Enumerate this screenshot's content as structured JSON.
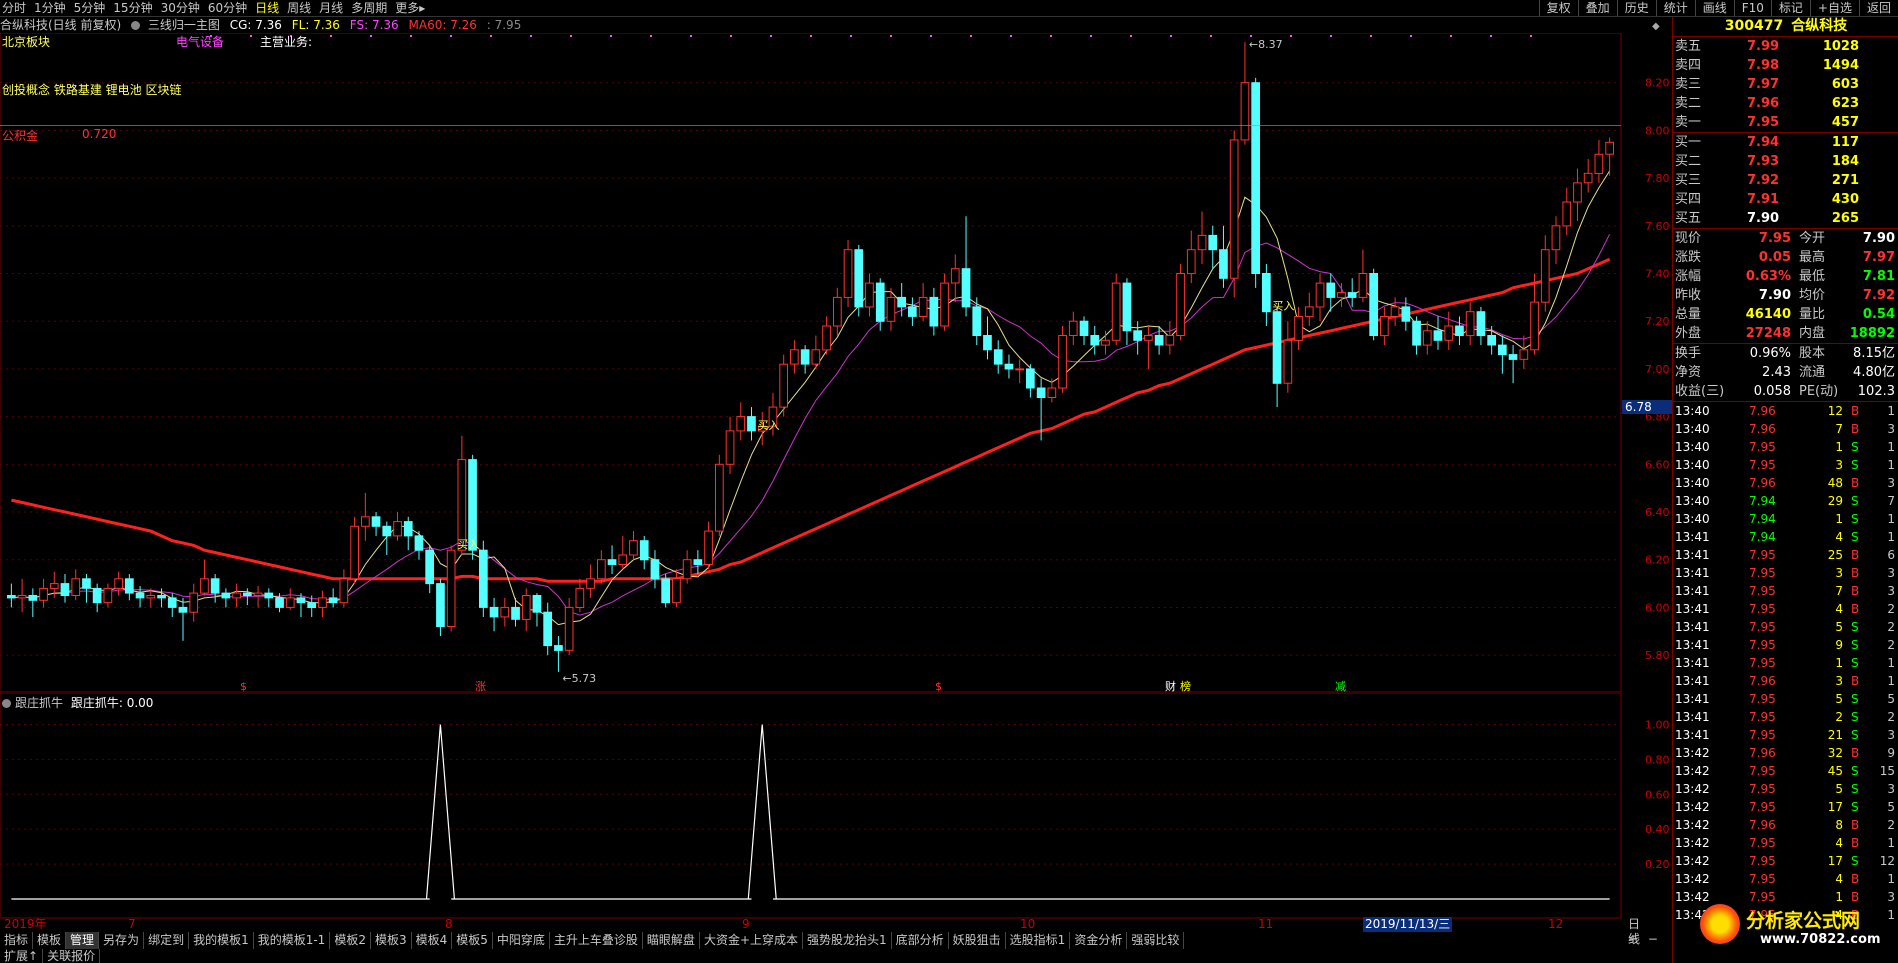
{
  "toolbar": {
    "periods": [
      "分时",
      "1分钟",
      "5分钟",
      "15分钟",
      "30分钟",
      "60分钟",
      "日线",
      "周线",
      "月线",
      "多周期",
      "更多▸"
    ],
    "active_period": "日线",
    "right_tools": [
      "复权",
      "叠加",
      "历史",
      "统计",
      "画线",
      "F10",
      "标记",
      "+自选",
      "返回"
    ]
  },
  "info": {
    "stock": "合纵科技(日线 前复权)",
    "indicator": "三线归一主图",
    "cg": "CG: 7.36",
    "fl": "FL: 7.36",
    "fs": "FS: 7.36",
    "ma60": "MA60: 7.26",
    "extra": ": 7.95"
  },
  "overlay": {
    "block": "北京板块",
    "sector": "电气设备",
    "main_business": "主营业务:",
    "concept": "创投概念 铁路基建 锂电池 区块链",
    "provident": "公积金",
    "provident_val": "0.720",
    "high_mark": "8.37",
    "low_mark": "5.73",
    "buy_label": "买入",
    "price_marker": "6.78"
  },
  "main_axis": [
    "8.20",
    "8.00",
    "7.80",
    "7.60",
    "7.40",
    "7.20",
    "7.00",
    "6.80",
    "6.60",
    "6.40",
    "6.20",
    "6.00",
    "5.80"
  ],
  "event_marks": [
    {
      "text": "$",
      "color": "#ff3030"
    },
    {
      "text": "涨",
      "color": "#ff3030"
    },
    {
      "text": "$",
      "color": "#ff3030"
    },
    {
      "text": "财",
      "color": "#ffffff"
    },
    {
      "text": "榜",
      "color": "#ffff00"
    },
    {
      "text": "减",
      "color": "#00ff00"
    }
  ],
  "sub": {
    "title": "跟庄抓牛",
    "value": "跟庄抓牛: 0.00",
    "axis": [
      "1.00",
      "0.80",
      "0.60",
      "0.40",
      "0.20"
    ]
  },
  "xaxis": {
    "labels": [
      "2019年",
      "7",
      "8",
      "9",
      "10",
      "11",
      "12"
    ],
    "cursor_date": "2019/11/13/三",
    "period": "日线"
  },
  "bottom_tabs": [
    "指标",
    "模板",
    "管理",
    "另存为",
    "绑定到",
    "我的模板1",
    "我的模板1-1",
    "模板2",
    "模板3",
    "模板4",
    "模板5",
    "中阳穿底",
    "主升上车叠诊股",
    "瞄眼解盘",
    "大资金+上穿成本",
    "强势股龙抬头1",
    "底部分析",
    "妖股狙击",
    "选股指标1",
    "资金分析",
    "强弱比较"
  ],
  "bottom_tabs_active": "管理",
  "bottom_line2": [
    "扩展↑",
    "关联报价"
  ],
  "quote": {
    "code": "300477",
    "name": "合纵科技",
    "asks": [
      {
        "label": "卖五",
        "price": "7.99",
        "vol": "1028"
      },
      {
        "label": "卖四",
        "price": "7.98",
        "vol": "1494"
      },
      {
        "label": "卖三",
        "price": "7.97",
        "vol": "603"
      },
      {
        "label": "卖二",
        "price": "7.96",
        "vol": "623"
      },
      {
        "label": "卖一",
        "price": "7.95",
        "vol": "457"
      }
    ],
    "bids": [
      {
        "label": "买一",
        "price": "7.94",
        "vol": "117"
      },
      {
        "label": "买二",
        "price": "7.93",
        "vol": "184"
      },
      {
        "label": "买三",
        "price": "7.92",
        "vol": "271"
      },
      {
        "label": "买四",
        "price": "7.91",
        "vol": "430"
      },
      {
        "label": "买五",
        "price": "7.90",
        "vol": "265"
      }
    ],
    "stats": [
      {
        "l1": "现价",
        "v1": "7.95",
        "c1": "#ff3030",
        "l2": "今开",
        "v2": "7.90",
        "c2": "#ffffff"
      },
      {
        "l1": "涨跌",
        "v1": "0.05",
        "c1": "#ff3030",
        "l2": "最高",
        "v2": "7.97",
        "c2": "#ff3030"
      },
      {
        "l1": "涨幅",
        "v1": "0.63%",
        "c1": "#ff3030",
        "l2": "最低",
        "v2": "7.81",
        "c2": "#00ff00"
      },
      {
        "l1": "昨收",
        "v1": "7.90",
        "c1": "#ffffff",
        "l2": "均价",
        "v2": "7.92",
        "c2": "#ff3030"
      },
      {
        "l1": "总量",
        "v1": "46140",
        "c1": "#ffff00",
        "l2": "量比",
        "v2": "0.54",
        "c2": "#00ff00"
      },
      {
        "l1": "外盘",
        "v1": "27248",
        "c1": "#ff3030",
        "l2": "内盘",
        "v2": "18892",
        "c2": "#00ff00"
      }
    ],
    "stats2": [
      {
        "l1": "换手",
        "v1": "0.96%",
        "l2": "股本",
        "v2": "8.15亿"
      },
      {
        "l1": "净资",
        "v1": "2.43",
        "l2": "流通",
        "v2": "4.80亿"
      },
      {
        "l1": "收益(三)",
        "v1": "0.058",
        "l2": "PE(动)",
        "v2": "102.3"
      }
    ]
  },
  "ticks": [
    {
      "t": "13:40",
      "p": "7.96",
      "v": "12",
      "s": "B",
      "n": "1"
    },
    {
      "t": "13:40",
      "p": "7.96",
      "v": "7",
      "s": "B",
      "n": "3"
    },
    {
      "t": "13:40",
      "p": "7.95",
      "v": "1",
      "s": "S",
      "n": "1"
    },
    {
      "t": "13:40",
      "p": "7.95",
      "v": "3",
      "s": "S",
      "n": "1"
    },
    {
      "t": "13:40",
      "p": "7.96",
      "v": "48",
      "s": "B",
      "n": "3"
    },
    {
      "t": "13:40",
      "p": "7.94",
      "v": "29",
      "s": "S",
      "n": "7"
    },
    {
      "t": "13:40",
      "p": "7.94",
      "v": "1",
      "s": "S",
      "n": "1"
    },
    {
      "t": "13:41",
      "p": "7.94",
      "v": "4",
      "s": "S",
      "n": "1"
    },
    {
      "t": "13:41",
      "p": "7.95",
      "v": "25",
      "s": "B",
      "n": "6"
    },
    {
      "t": "13:41",
      "p": "7.95",
      "v": "3",
      "s": "B",
      "n": "3"
    },
    {
      "t": "13:41",
      "p": "7.95",
      "v": "7",
      "s": "B",
      "n": "3"
    },
    {
      "t": "13:41",
      "p": "7.95",
      "v": "4",
      "s": "B",
      "n": "2"
    },
    {
      "t": "13:41",
      "p": "7.95",
      "v": "5",
      "s": "S",
      "n": "2"
    },
    {
      "t": "13:41",
      "p": "7.95",
      "v": "9",
      "s": "S",
      "n": "2"
    },
    {
      "t": "13:41",
      "p": "7.95",
      "v": "1",
      "s": "S",
      "n": "1"
    },
    {
      "t": "13:41",
      "p": "7.96",
      "v": "3",
      "s": "B",
      "n": "1"
    },
    {
      "t": "13:41",
      "p": "7.95",
      "v": "5",
      "s": "S",
      "n": "5"
    },
    {
      "t": "13:41",
      "p": "7.95",
      "v": "2",
      "s": "S",
      "n": "2"
    },
    {
      "t": "13:41",
      "p": "7.95",
      "v": "21",
      "s": "S",
      "n": "3"
    },
    {
      "t": "13:42",
      "p": "7.96",
      "v": "32",
      "s": "B",
      "n": "9"
    },
    {
      "t": "13:42",
      "p": "7.95",
      "v": "45",
      "s": "S",
      "n": "15"
    },
    {
      "t": "13:42",
      "p": "7.95",
      "v": "5",
      "s": "S",
      "n": "3"
    },
    {
      "t": "13:42",
      "p": "7.95",
      "v": "17",
      "s": "S",
      "n": "5"
    },
    {
      "t": "13:42",
      "p": "7.96",
      "v": "8",
      "s": "B",
      "n": "2"
    },
    {
      "t": "13:42",
      "p": "7.95",
      "v": "4",
      "s": "B",
      "n": "1"
    },
    {
      "t": "13:42",
      "p": "7.95",
      "v": "17",
      "s": "S",
      "n": "12"
    },
    {
      "t": "13:42",
      "p": "7.95",
      "v": "4",
      "s": "B",
      "n": "1"
    },
    {
      "t": "13:42",
      "p": "7.95",
      "v": "1",
      "s": "B",
      "n": "3"
    },
    {
      "t": "13:42",
      "p": "7.95",
      "v": "4",
      "s": "B",
      "n": "1"
    }
  ],
  "watermark": {
    "line1": "分析家公式网",
    "line2": "www.70822.com"
  },
  "chart_data": {
    "type": "candlestick",
    "title": "合纵科技(日线 前复权)",
    "ylim": [
      5.7,
      8.4
    ],
    "candles": [
      [
        6.05,
        6.04,
        6.1,
        6.0
      ],
      [
        6.04,
        6.05,
        6.12,
        5.98
      ],
      [
        6.05,
        6.03,
        6.08,
        5.96
      ],
      [
        6.03,
        6.08,
        6.12,
        6.0
      ],
      [
        6.08,
        6.1,
        6.15,
        6.04
      ],
      [
        6.1,
        6.05,
        6.14,
        6.02
      ],
      [
        6.05,
        6.12,
        6.16,
        6.03
      ],
      [
        6.12,
        6.08,
        6.14,
        6.02
      ],
      [
        6.08,
        6.02,
        6.1,
        5.98
      ],
      [
        6.02,
        6.08,
        6.1,
        6.0
      ],
      [
        6.08,
        6.12,
        6.15,
        6.05
      ],
      [
        6.12,
        6.06,
        6.14,
        6.03
      ],
      [
        6.06,
        6.04,
        6.09,
        6.0
      ],
      [
        6.04,
        6.05,
        6.08,
        6.0
      ],
      [
        6.05,
        6.04,
        6.08,
        6.0
      ],
      [
        6.04,
        6.0,
        6.06,
        5.96
      ],
      [
        6.0,
        5.98,
        6.04,
        5.86
      ],
      [
        5.98,
        6.06,
        6.1,
        5.94
      ],
      [
        6.06,
        6.12,
        6.2,
        6.05
      ],
      [
        6.12,
        6.06,
        6.14,
        6.02
      ],
      [
        6.06,
        6.04,
        6.08,
        6.0
      ],
      [
        6.04,
        6.06,
        6.1,
        6.0
      ],
      [
        6.06,
        6.05,
        6.08,
        6.01
      ],
      [
        6.05,
        6.06,
        6.09,
        6.0
      ],
      [
        6.06,
        6.04,
        6.08,
        6.0
      ],
      [
        6.04,
        6.0,
        6.06,
        5.98
      ],
      [
        6.0,
        6.04,
        6.08,
        5.99
      ],
      [
        6.04,
        6.02,
        6.06,
        5.96
      ],
      [
        6.02,
        6.0,
        6.05,
        5.96
      ],
      [
        6.0,
        6.04,
        6.07,
        5.96
      ],
      [
        6.04,
        6.02,
        6.08,
        6.0
      ],
      [
        6.02,
        6.12,
        6.16,
        6.0
      ],
      [
        6.12,
        6.34,
        6.38,
        6.1
      ],
      [
        6.34,
        6.38,
        6.48,
        6.28
      ],
      [
        6.38,
        6.34,
        6.4,
        6.3
      ],
      [
        6.34,
        6.3,
        6.36,
        6.22
      ],
      [
        6.3,
        6.36,
        6.4,
        6.28
      ],
      [
        6.36,
        6.3,
        6.38,
        6.24
      ],
      [
        6.3,
        6.24,
        6.32,
        6.2
      ],
      [
        6.24,
        6.1,
        6.26,
        6.06
      ],
      [
        6.1,
        5.92,
        6.12,
        5.88
      ],
      [
        5.92,
        6.24,
        6.26,
        5.9
      ],
      [
        6.24,
        6.62,
        6.72,
        6.22
      ],
      [
        6.62,
        6.24,
        6.64,
        6.2
      ],
      [
        6.24,
        6.0,
        6.28,
        5.96
      ],
      [
        6.0,
        5.96,
        6.04,
        5.9
      ],
      [
        5.96,
        6.0,
        6.04,
        5.92
      ],
      [
        6.0,
        5.95,
        6.04,
        5.92
      ],
      [
        5.95,
        6.05,
        6.08,
        5.9
      ],
      [
        6.05,
        5.98,
        6.06,
        5.92
      ],
      [
        5.98,
        5.84,
        6.02,
        5.8
      ],
      [
        5.84,
        5.82,
        5.88,
        5.73
      ],
      [
        5.82,
        6.0,
        6.04,
        5.8
      ],
      [
        6.0,
        6.08,
        6.12,
        5.98
      ],
      [
        6.08,
        6.12,
        6.18,
        6.04
      ],
      [
        6.12,
        6.2,
        6.24,
        6.1
      ],
      [
        6.2,
        6.18,
        6.26,
        6.14
      ],
      [
        6.18,
        6.22,
        6.3,
        6.16
      ],
      [
        6.22,
        6.28,
        6.32,
        6.2
      ],
      [
        6.28,
        6.2,
        6.3,
        6.16
      ],
      [
        6.2,
        6.12,
        6.24,
        6.08
      ],
      [
        6.12,
        6.02,
        6.14,
        6.0
      ],
      [
        6.02,
        6.12,
        6.16,
        6.0
      ],
      [
        6.12,
        6.2,
        6.24,
        6.1
      ],
      [
        6.2,
        6.18,
        6.24,
        6.14
      ],
      [
        6.18,
        6.32,
        6.36,
        6.16
      ],
      [
        6.32,
        6.6,
        6.64,
        6.3
      ],
      [
        6.6,
        6.74,
        6.8,
        6.56
      ],
      [
        6.74,
        6.8,
        6.86,
        6.7
      ],
      [
        6.8,
        6.74,
        6.84,
        6.7
      ],
      [
        6.74,
        6.76,
        6.82,
        6.68
      ],
      [
        6.76,
        6.84,
        6.9,
        6.72
      ],
      [
        6.84,
        7.02,
        7.06,
        6.8
      ],
      [
        7.02,
        7.08,
        7.12,
        6.98
      ],
      [
        7.08,
        7.02,
        7.1,
        6.98
      ],
      [
        7.02,
        7.08,
        7.14,
        7.0
      ],
      [
        7.08,
        7.18,
        7.22,
        7.06
      ],
      [
        7.18,
        7.3,
        7.34,
        7.14
      ],
      [
        7.3,
        7.5,
        7.54,
        7.26
      ],
      [
        7.5,
        7.26,
        7.52,
        7.22
      ],
      [
        7.26,
        7.36,
        7.4,
        7.22
      ],
      [
        7.36,
        7.2,
        7.38,
        7.16
      ],
      [
        7.2,
        7.3,
        7.34,
        7.16
      ],
      [
        7.3,
        7.26,
        7.36,
        7.22
      ],
      [
        7.26,
        7.22,
        7.3,
        7.18
      ],
      [
        7.22,
        7.3,
        7.36,
        7.2
      ],
      [
        7.3,
        7.18,
        7.34,
        7.14
      ],
      [
        7.18,
        7.36,
        7.4,
        7.16
      ],
      [
        7.36,
        7.42,
        7.48,
        7.28
      ],
      [
        7.42,
        7.26,
        7.64,
        7.22
      ],
      [
        7.26,
        7.14,
        7.3,
        7.1
      ],
      [
        7.14,
        7.08,
        7.22,
        7.04
      ],
      [
        7.08,
        7.02,
        7.12,
        6.98
      ],
      [
        7.02,
        7.0,
        7.06,
        6.96
      ],
      [
        7.0,
        7.0,
        7.04,
        6.94
      ],
      [
        7.0,
        6.92,
        7.02,
        6.88
      ],
      [
        6.92,
        6.88,
        6.96,
        6.7
      ],
      [
        6.88,
        6.92,
        6.96,
        6.86
      ],
      [
        6.92,
        7.14,
        7.18,
        6.9
      ],
      [
        7.14,
        7.2,
        7.24,
        7.1
      ],
      [
        7.2,
        7.14,
        7.22,
        7.1
      ],
      [
        7.14,
        7.1,
        7.18,
        7.06
      ],
      [
        7.1,
        7.12,
        7.16,
        7.06
      ],
      [
        7.12,
        7.36,
        7.4,
        7.1
      ],
      [
        7.36,
        7.16,
        7.38,
        7.1
      ],
      [
        7.16,
        7.12,
        7.2,
        7.06
      ],
      [
        7.12,
        7.14,
        7.18,
        7.0
      ],
      [
        7.14,
        7.1,
        7.18,
        7.06
      ],
      [
        7.1,
        7.14,
        7.2,
        7.06
      ],
      [
        7.14,
        7.4,
        7.44,
        7.12
      ],
      [
        7.4,
        7.5,
        7.58,
        7.36
      ],
      [
        7.5,
        7.56,
        7.66,
        7.44
      ],
      [
        7.56,
        7.5,
        7.6,
        7.42
      ],
      [
        7.5,
        7.38,
        7.6,
        7.34
      ],
      [
        7.38,
        7.96,
        8.0,
        7.3
      ],
      [
        7.96,
        8.2,
        8.37,
        7.94
      ],
      [
        8.2,
        7.4,
        8.22,
        7.34
      ],
      [
        7.4,
        7.24,
        7.44,
        7.18
      ],
      [
        7.24,
        6.94,
        7.26,
        6.84
      ],
      [
        6.94,
        7.12,
        7.2,
        6.9
      ],
      [
        7.12,
        7.22,
        7.26,
        7.08
      ],
      [
        7.22,
        7.26,
        7.32,
        7.18
      ],
      [
        7.26,
        7.36,
        7.4,
        7.2
      ],
      [
        7.36,
        7.3,
        7.4,
        7.24
      ],
      [
        7.3,
        7.32,
        7.36,
        7.26
      ],
      [
        7.32,
        7.3,
        7.38,
        7.26
      ],
      [
        7.3,
        7.4,
        7.5,
        7.28
      ],
      [
        7.4,
        7.14,
        7.42,
        7.12
      ],
      [
        7.14,
        7.22,
        7.26,
        7.1
      ],
      [
        7.22,
        7.26,
        7.3,
        7.18
      ],
      [
        7.26,
        7.2,
        7.3,
        7.16
      ],
      [
        7.2,
        7.1,
        7.22,
        7.06
      ],
      [
        7.1,
        7.16,
        7.2,
        7.06
      ],
      [
        7.16,
        7.12,
        7.22,
        7.08
      ],
      [
        7.12,
        7.18,
        7.24,
        7.08
      ],
      [
        7.18,
        7.14,
        7.22,
        7.1
      ],
      [
        7.14,
        7.24,
        7.28,
        7.1
      ],
      [
        7.24,
        7.14,
        7.26,
        7.1
      ],
      [
        7.14,
        7.1,
        7.18,
        7.06
      ],
      [
        7.1,
        7.06,
        7.14,
        6.98
      ],
      [
        7.06,
        7.04,
        7.1,
        6.94
      ],
      [
        7.04,
        7.08,
        7.14,
        7.0
      ],
      [
        7.08,
        7.28,
        7.4,
        7.06
      ],
      [
        7.28,
        7.5,
        7.56,
        7.24
      ],
      [
        7.5,
        7.6,
        7.64,
        7.44
      ],
      [
        7.6,
        7.7,
        7.76,
        7.56
      ],
      [
        7.7,
        7.78,
        7.84,
        7.62
      ],
      [
        7.78,
        7.82,
        7.88,
        7.74
      ],
      [
        7.82,
        7.9,
        7.96,
        7.78
      ],
      [
        7.9,
        7.95,
        7.97,
        7.81
      ]
    ],
    "ma60": [
      6.45,
      6.44,
      6.43,
      6.42,
      6.41,
      6.4,
      6.39,
      6.38,
      6.37,
      6.36,
      6.35,
      6.34,
      6.33,
      6.32,
      6.3,
      6.28,
      6.27,
      6.26,
      6.24,
      6.23,
      6.22,
      6.21,
      6.2,
      6.19,
      6.18,
      6.17,
      6.16,
      6.15,
      6.14,
      6.13,
      6.12,
      6.12,
      6.12,
      6.12,
      6.12,
      6.12,
      6.12,
      6.12,
      6.12,
      6.12,
      6.12,
      6.12,
      6.13,
      6.13,
      6.12,
      6.12,
      6.12,
      6.12,
      6.12,
      6.12,
      6.11,
      6.11,
      6.11,
      6.11,
      6.11,
      6.11,
      6.12,
      6.12,
      6.12,
      6.12,
      6.12,
      6.12,
      6.12,
      6.13,
      6.14,
      6.15,
      6.16,
      6.18,
      6.19,
      6.21,
      6.23,
      6.25,
      6.27,
      6.29,
      6.31,
      6.33,
      6.35,
      6.37,
      6.39,
      6.41,
      6.43,
      6.45,
      6.47,
      6.49,
      6.51,
      6.53,
      6.55,
      6.57,
      6.59,
      6.61,
      6.63,
      6.65,
      6.67,
      6.69,
      6.71,
      6.73,
      6.74,
      6.75,
      6.77,
      6.79,
      6.81,
      6.82,
      6.84,
      6.86,
      6.88,
      6.9,
      6.91,
      6.93,
      6.94,
      6.96,
      6.98,
      7.0,
      7.02,
      7.04,
      7.06,
      7.08,
      7.09,
      7.1,
      7.11,
      7.12,
      7.13,
      7.14,
      7.15,
      7.16,
      7.17,
      7.18,
      7.19,
      7.2,
      7.21,
      7.22,
      7.23,
      7.24,
      7.25,
      7.26,
      7.27,
      7.28,
      7.29,
      7.3,
      7.31,
      7.32,
      7.34,
      7.35,
      7.36,
      7.37,
      7.38,
      7.39,
      7.4,
      7.42,
      7.44,
      7.46
    ],
    "sub_series": {
      "name": "跟庄抓牛",
      "spikes_at": [
        40,
        70,
        153
      ],
      "ylim": [
        0,
        1.1
      ]
    }
  }
}
